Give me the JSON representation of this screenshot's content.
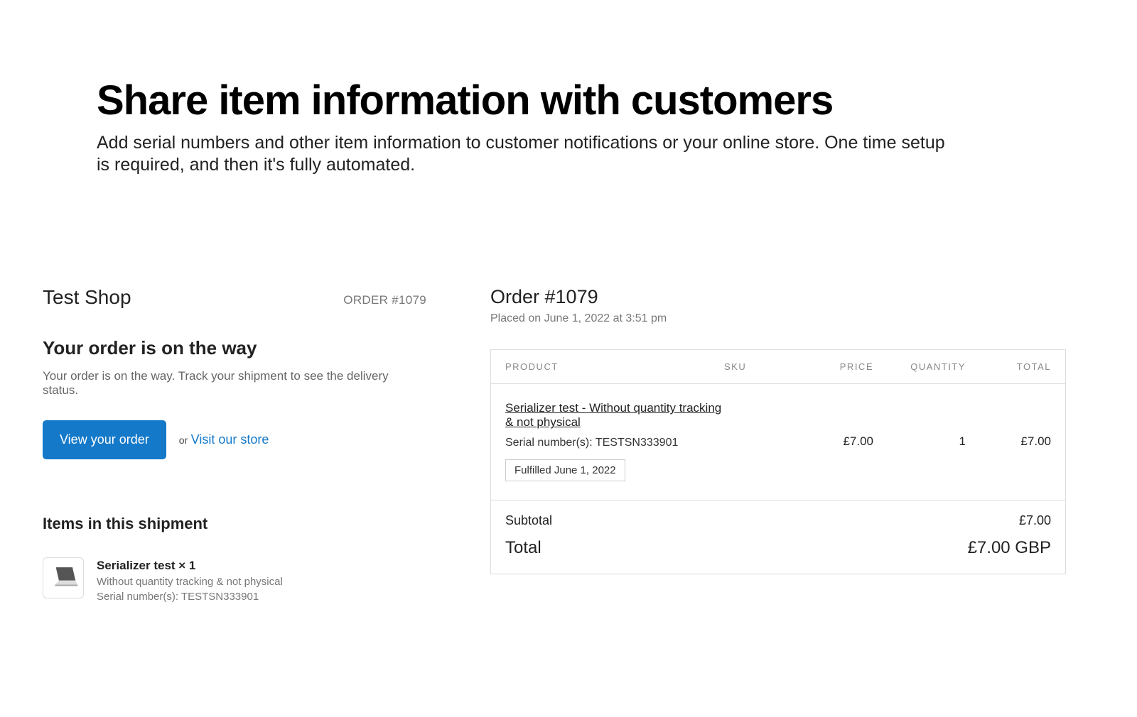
{
  "heading": "Share item information with customers",
  "subheading": "Add serial numbers and other item information to customer notifications or your online store. One time setup is required, and then it's fully automated.",
  "left": {
    "shop_name": "Test Shop",
    "order_label": "ORDER #1079",
    "status_title": "Your order is on the way",
    "status_desc": "Your order is on the way. Track your shipment to see the delivery status.",
    "view_order_btn": "View your order",
    "or_text": "or",
    "visit_store_link": "Visit our store",
    "shipment_heading": "Items in this shipment",
    "item": {
      "name": "Serializer test × 1",
      "variant": "Without quantity tracking & not physical",
      "serial": "Serial number(s): TESTSN333901"
    }
  },
  "right": {
    "order_title": "Order #1079",
    "placed_on": "Placed on June 1, 2022 at 3:51 pm",
    "columns": {
      "product": "PRODUCT",
      "sku": "SKU",
      "price": "PRICE",
      "quantity": "QUANTITY",
      "total": "TOTAL"
    },
    "row": {
      "product_name": "Serializer test - Without quantity tracking & not physical",
      "serial": "Serial number(s): TESTSN333901",
      "fulfilled_badge": "Fulfilled June 1, 2022",
      "sku": "",
      "price": "£7.00",
      "quantity": "1",
      "total": "£7.00"
    },
    "subtotal_label": "Subtotal",
    "subtotal_value": "£7.00",
    "total_label": "Total",
    "total_value": "£7.00 GBP"
  }
}
